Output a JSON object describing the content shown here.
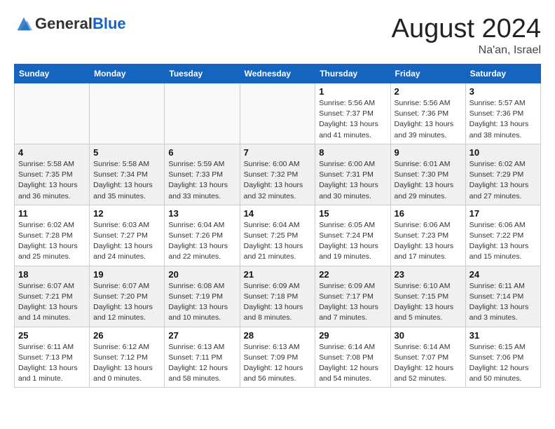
{
  "header": {
    "logo_general": "General",
    "logo_blue": "Blue",
    "month_year": "August 2024",
    "location": "Na'an, Israel"
  },
  "weekdays": [
    "Sunday",
    "Monday",
    "Tuesday",
    "Wednesday",
    "Thursday",
    "Friday",
    "Saturday"
  ],
  "weeks": [
    [
      {
        "day": "",
        "info": ""
      },
      {
        "day": "",
        "info": ""
      },
      {
        "day": "",
        "info": ""
      },
      {
        "day": "",
        "info": ""
      },
      {
        "day": "1",
        "info": "Sunrise: 5:56 AM\nSunset: 7:37 PM\nDaylight: 13 hours\nand 41 minutes."
      },
      {
        "day": "2",
        "info": "Sunrise: 5:56 AM\nSunset: 7:36 PM\nDaylight: 13 hours\nand 39 minutes."
      },
      {
        "day": "3",
        "info": "Sunrise: 5:57 AM\nSunset: 7:36 PM\nDaylight: 13 hours\nand 38 minutes."
      }
    ],
    [
      {
        "day": "4",
        "info": "Sunrise: 5:58 AM\nSunset: 7:35 PM\nDaylight: 13 hours\nand 36 minutes."
      },
      {
        "day": "5",
        "info": "Sunrise: 5:58 AM\nSunset: 7:34 PM\nDaylight: 13 hours\nand 35 minutes."
      },
      {
        "day": "6",
        "info": "Sunrise: 5:59 AM\nSunset: 7:33 PM\nDaylight: 13 hours\nand 33 minutes."
      },
      {
        "day": "7",
        "info": "Sunrise: 6:00 AM\nSunset: 7:32 PM\nDaylight: 13 hours\nand 32 minutes."
      },
      {
        "day": "8",
        "info": "Sunrise: 6:00 AM\nSunset: 7:31 PM\nDaylight: 13 hours\nand 30 minutes."
      },
      {
        "day": "9",
        "info": "Sunrise: 6:01 AM\nSunset: 7:30 PM\nDaylight: 13 hours\nand 29 minutes."
      },
      {
        "day": "10",
        "info": "Sunrise: 6:02 AM\nSunset: 7:29 PM\nDaylight: 13 hours\nand 27 minutes."
      }
    ],
    [
      {
        "day": "11",
        "info": "Sunrise: 6:02 AM\nSunset: 7:28 PM\nDaylight: 13 hours\nand 25 minutes."
      },
      {
        "day": "12",
        "info": "Sunrise: 6:03 AM\nSunset: 7:27 PM\nDaylight: 13 hours\nand 24 minutes."
      },
      {
        "day": "13",
        "info": "Sunrise: 6:04 AM\nSunset: 7:26 PM\nDaylight: 13 hours\nand 22 minutes."
      },
      {
        "day": "14",
        "info": "Sunrise: 6:04 AM\nSunset: 7:25 PM\nDaylight: 13 hours\nand 21 minutes."
      },
      {
        "day": "15",
        "info": "Sunrise: 6:05 AM\nSunset: 7:24 PM\nDaylight: 13 hours\nand 19 minutes."
      },
      {
        "day": "16",
        "info": "Sunrise: 6:06 AM\nSunset: 7:23 PM\nDaylight: 13 hours\nand 17 minutes."
      },
      {
        "day": "17",
        "info": "Sunrise: 6:06 AM\nSunset: 7:22 PM\nDaylight: 13 hours\nand 15 minutes."
      }
    ],
    [
      {
        "day": "18",
        "info": "Sunrise: 6:07 AM\nSunset: 7:21 PM\nDaylight: 13 hours\nand 14 minutes."
      },
      {
        "day": "19",
        "info": "Sunrise: 6:07 AM\nSunset: 7:20 PM\nDaylight: 13 hours\nand 12 minutes."
      },
      {
        "day": "20",
        "info": "Sunrise: 6:08 AM\nSunset: 7:19 PM\nDaylight: 13 hours\nand 10 minutes."
      },
      {
        "day": "21",
        "info": "Sunrise: 6:09 AM\nSunset: 7:18 PM\nDaylight: 13 hours\nand 8 minutes."
      },
      {
        "day": "22",
        "info": "Sunrise: 6:09 AM\nSunset: 7:17 PM\nDaylight: 13 hours\nand 7 minutes."
      },
      {
        "day": "23",
        "info": "Sunrise: 6:10 AM\nSunset: 7:15 PM\nDaylight: 13 hours\nand 5 minutes."
      },
      {
        "day": "24",
        "info": "Sunrise: 6:11 AM\nSunset: 7:14 PM\nDaylight: 13 hours\nand 3 minutes."
      }
    ],
    [
      {
        "day": "25",
        "info": "Sunrise: 6:11 AM\nSunset: 7:13 PM\nDaylight: 13 hours\nand 1 minute."
      },
      {
        "day": "26",
        "info": "Sunrise: 6:12 AM\nSunset: 7:12 PM\nDaylight: 13 hours\nand 0 minutes."
      },
      {
        "day": "27",
        "info": "Sunrise: 6:13 AM\nSunset: 7:11 PM\nDaylight: 12 hours\nand 58 minutes."
      },
      {
        "day": "28",
        "info": "Sunrise: 6:13 AM\nSunset: 7:09 PM\nDaylight: 12 hours\nand 56 minutes."
      },
      {
        "day": "29",
        "info": "Sunrise: 6:14 AM\nSunset: 7:08 PM\nDaylight: 12 hours\nand 54 minutes."
      },
      {
        "day": "30",
        "info": "Sunrise: 6:14 AM\nSunset: 7:07 PM\nDaylight: 12 hours\nand 52 minutes."
      },
      {
        "day": "31",
        "info": "Sunrise: 6:15 AM\nSunset: 7:06 PM\nDaylight: 12 hours\nand 50 minutes."
      }
    ]
  ]
}
